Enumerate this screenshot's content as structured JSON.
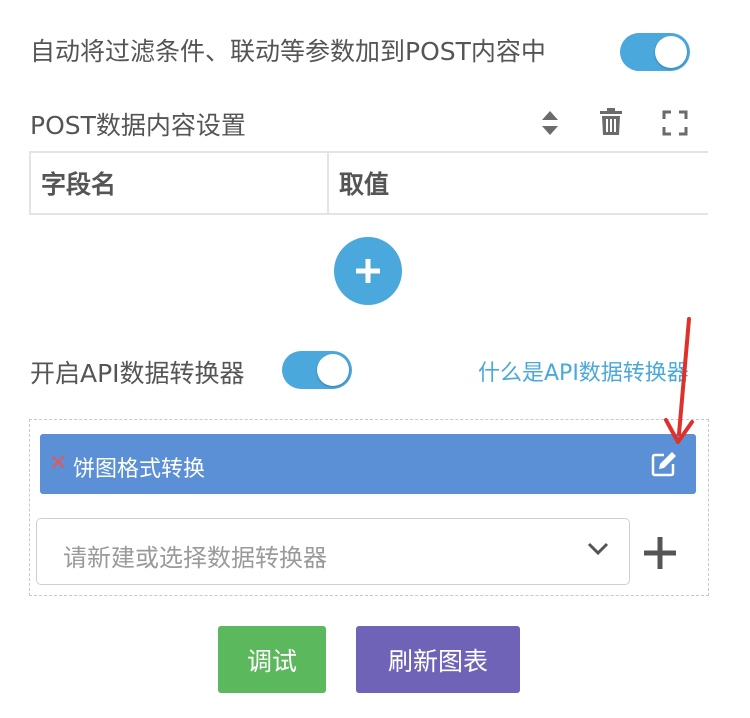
{
  "auto_params": {
    "label": "自动将过滤条件、联动等参数加到POST内容中",
    "enabled": true
  },
  "post_section": {
    "title": "POST数据内容设置",
    "icons": [
      "sort-icon",
      "trash-icon",
      "fullscreen-icon"
    ],
    "table": {
      "columns": [
        "字段名",
        "取值"
      ]
    }
  },
  "api_converter": {
    "label": "开启API数据转换器",
    "enabled": true,
    "help_link": "什么是API数据转换器",
    "items": [
      {
        "name": "饼图格式转换"
      }
    ],
    "select_placeholder": "请新建或选择数据转换器"
  },
  "buttons": {
    "debug": "调试",
    "refresh": "刷新图表"
  },
  "colors": {
    "accent": "#4aa8dc",
    "converter_bar": "#5b8fd6",
    "debug_button": "#5cb85c",
    "refresh_button": "#6f63b8",
    "annotation_arrow": "#e0302a",
    "remove_x": "#e05a5a"
  }
}
